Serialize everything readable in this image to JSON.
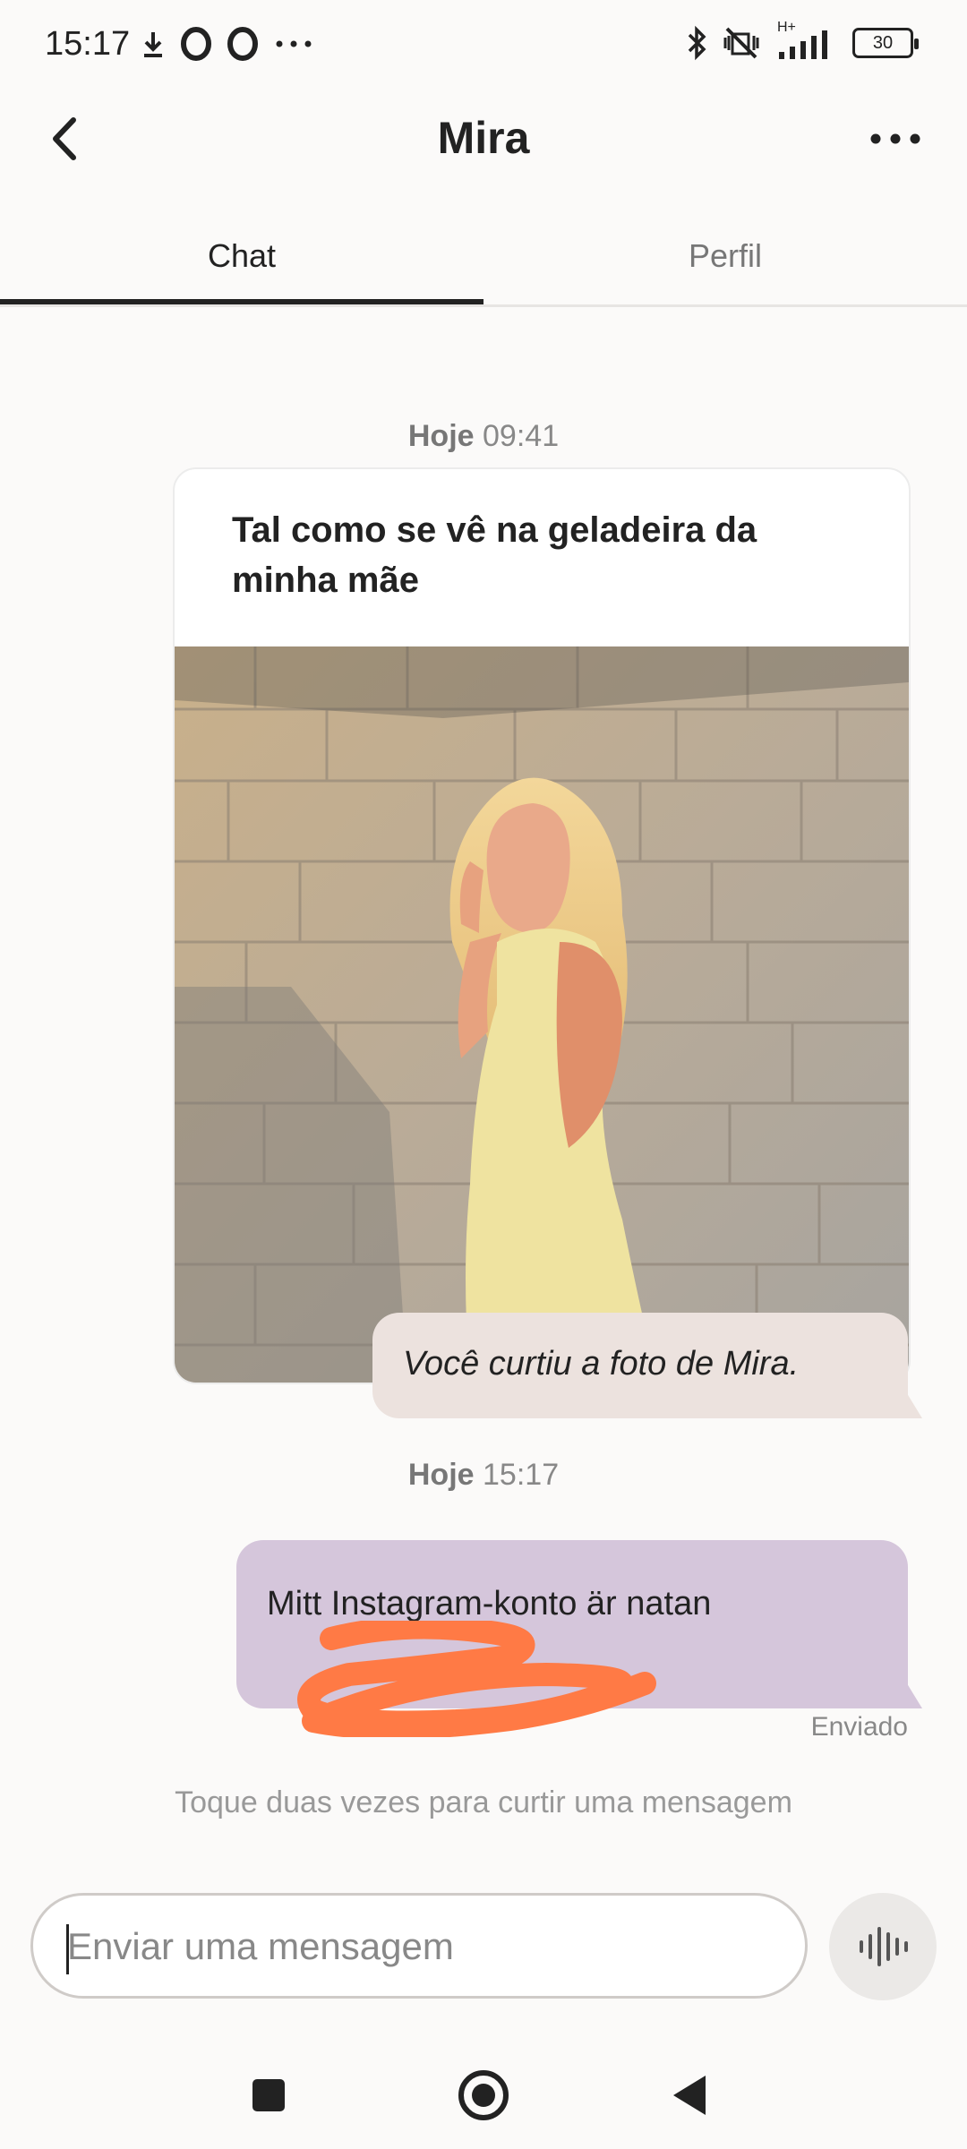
{
  "status_bar": {
    "time": "15:17",
    "left_icons": [
      "download-icon",
      "opera-icon",
      "opera-icon",
      "more-dots-icon"
    ],
    "right_icons": [
      "bluetooth-icon",
      "vibrate-off-icon",
      "signal-icon"
    ],
    "network": "H+",
    "battery": "30"
  },
  "header": {
    "title": "Mira",
    "back_icon": "chevron-left-icon",
    "more_icon": "more-horizontal-icon"
  },
  "tabs": [
    {
      "label": "Chat",
      "active": true
    },
    {
      "label": "Perfil",
      "active": false
    }
  ],
  "chat": {
    "groups": [
      {
        "day": "Hoje",
        "time": "09:41",
        "card": {
          "caption": "Tal como se vê na geladeira da minha mãe"
        },
        "liked_text": "Você curtiu a foto de Mira."
      },
      {
        "day": "Hoje",
        "time": "15:17",
        "message": "Mitt Instagram-konto är natan",
        "status": "Enviado"
      }
    ],
    "hint": "Toque duas vezes para curtir uma mensagem"
  },
  "composer": {
    "placeholder": "Enviar uma mensagem",
    "voice_icon": "voice-wave-icon"
  },
  "colors": {
    "liked_bubble": "#ece2de",
    "sent_bubble": "#d5c6db",
    "scribble": "#ff7a45"
  },
  "nav_bar": [
    "recents-square-icon",
    "home-circle-icon",
    "back-triangle-icon"
  ]
}
